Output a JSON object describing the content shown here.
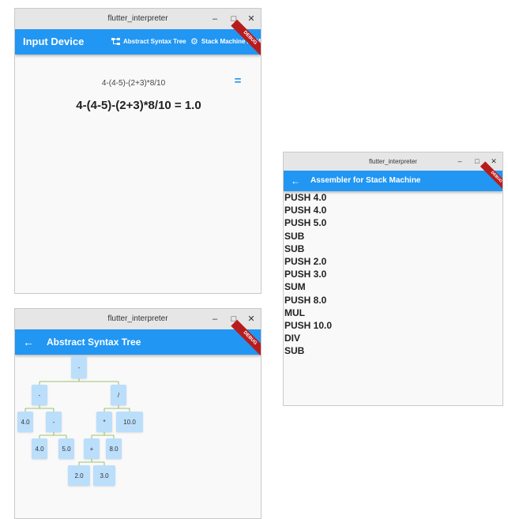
{
  "main_window": {
    "title": "flutter_interpreter",
    "controls": {
      "minimize": "–",
      "maximize": "□",
      "close": "✕"
    },
    "appbar_title": "Input Device",
    "action_ast": "Abstract Syntax Tree",
    "action_asm": "Stack Machine ASM",
    "debug_label": "DEBUG",
    "input_text": "4-(4-5)-(2+3)*8/10",
    "equals_button": "=",
    "result_text": "4-(4-5)-(2+3)*8/10 = 1.0"
  },
  "ast_window": {
    "title": "flutter_interpreter",
    "controls": {
      "minimize": "–",
      "maximize": "□",
      "close": "✕"
    },
    "appbar_title": "Abstract Syntax Tree",
    "debug_label": "DEBUG",
    "nodes": {
      "root": "-",
      "left": "-",
      "right": "/",
      "num_4_0": "4.0",
      "sub_inner": "-",
      "mul": "*",
      "num_10_0": "10.0",
      "num_4_0b": "4.0",
      "num_5_0": "5.0",
      "plus": "+",
      "num_8_0": "8.0",
      "num_2_0": "2.0",
      "num_3_0": "3.0"
    }
  },
  "asm_window": {
    "title": "flutter_interpreter",
    "controls": {
      "minimize": "–",
      "maximize": "□",
      "close": "✕"
    },
    "appbar_title": "Assembler for Stack Machine",
    "debug_label": "DEBUG",
    "lines": [
      "PUSH 4.0",
      "PUSH 4.0",
      "PUSH 5.0",
      "SUB",
      "SUB",
      "PUSH 2.0",
      "PUSH 3.0",
      "SUM",
      "PUSH 8.0",
      "MUL",
      "PUSH 10.0",
      "DIV",
      "SUB"
    ]
  },
  "colors": {
    "appbar": "#2196f3",
    "node": "#bbdefb",
    "edge": "#7cb342",
    "debug": "#b71c1c"
  }
}
